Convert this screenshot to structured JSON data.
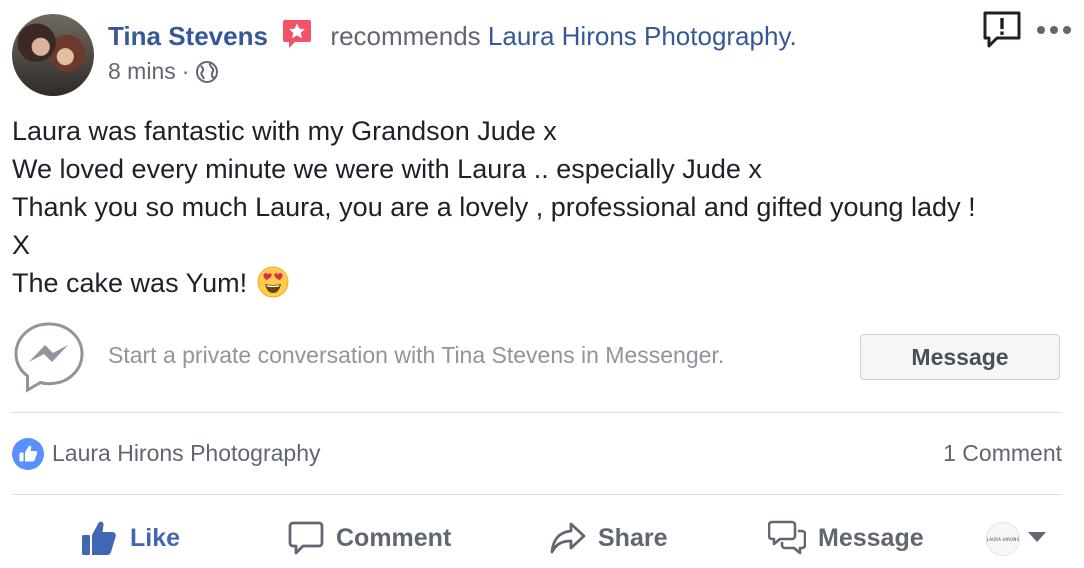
{
  "post": {
    "author": "Tina Stevens",
    "recommends_text": "recommends",
    "page_name": "Laura Hirons Photography.",
    "time": "8 mins",
    "separator": "·",
    "body_lines": [
      "Laura was fantastic with my Grandson Jude x",
      "We loved every minute we were with Laura .. especially Jude x",
      "Thank you so much Laura, you are a lovely , professional and gifted young lady !",
      "X",
      "The cake was Yum!"
    ],
    "icons": {
      "recommend_badge": "star-badge-icon",
      "audience": "globe-icon",
      "report": "report-icon",
      "more": "more-options-icon",
      "emoji": "heart-eyes-emoji-icon"
    }
  },
  "messenger": {
    "prompt": "Start a private conversation with Tina Stevens in Messenger.",
    "button_label": "Message"
  },
  "reactions": {
    "liked_by": "Laura Hirons Photography",
    "comment_count": "1 Comment"
  },
  "actions": {
    "like": "Like",
    "comment": "Comment",
    "share": "Share",
    "message": "Message",
    "page_avatar_text": "LAURA HIRONS"
  },
  "colors": {
    "link": "#365899",
    "like_blue": "#4267b2",
    "badge_pink": "#f35369",
    "muted": "#606770"
  }
}
